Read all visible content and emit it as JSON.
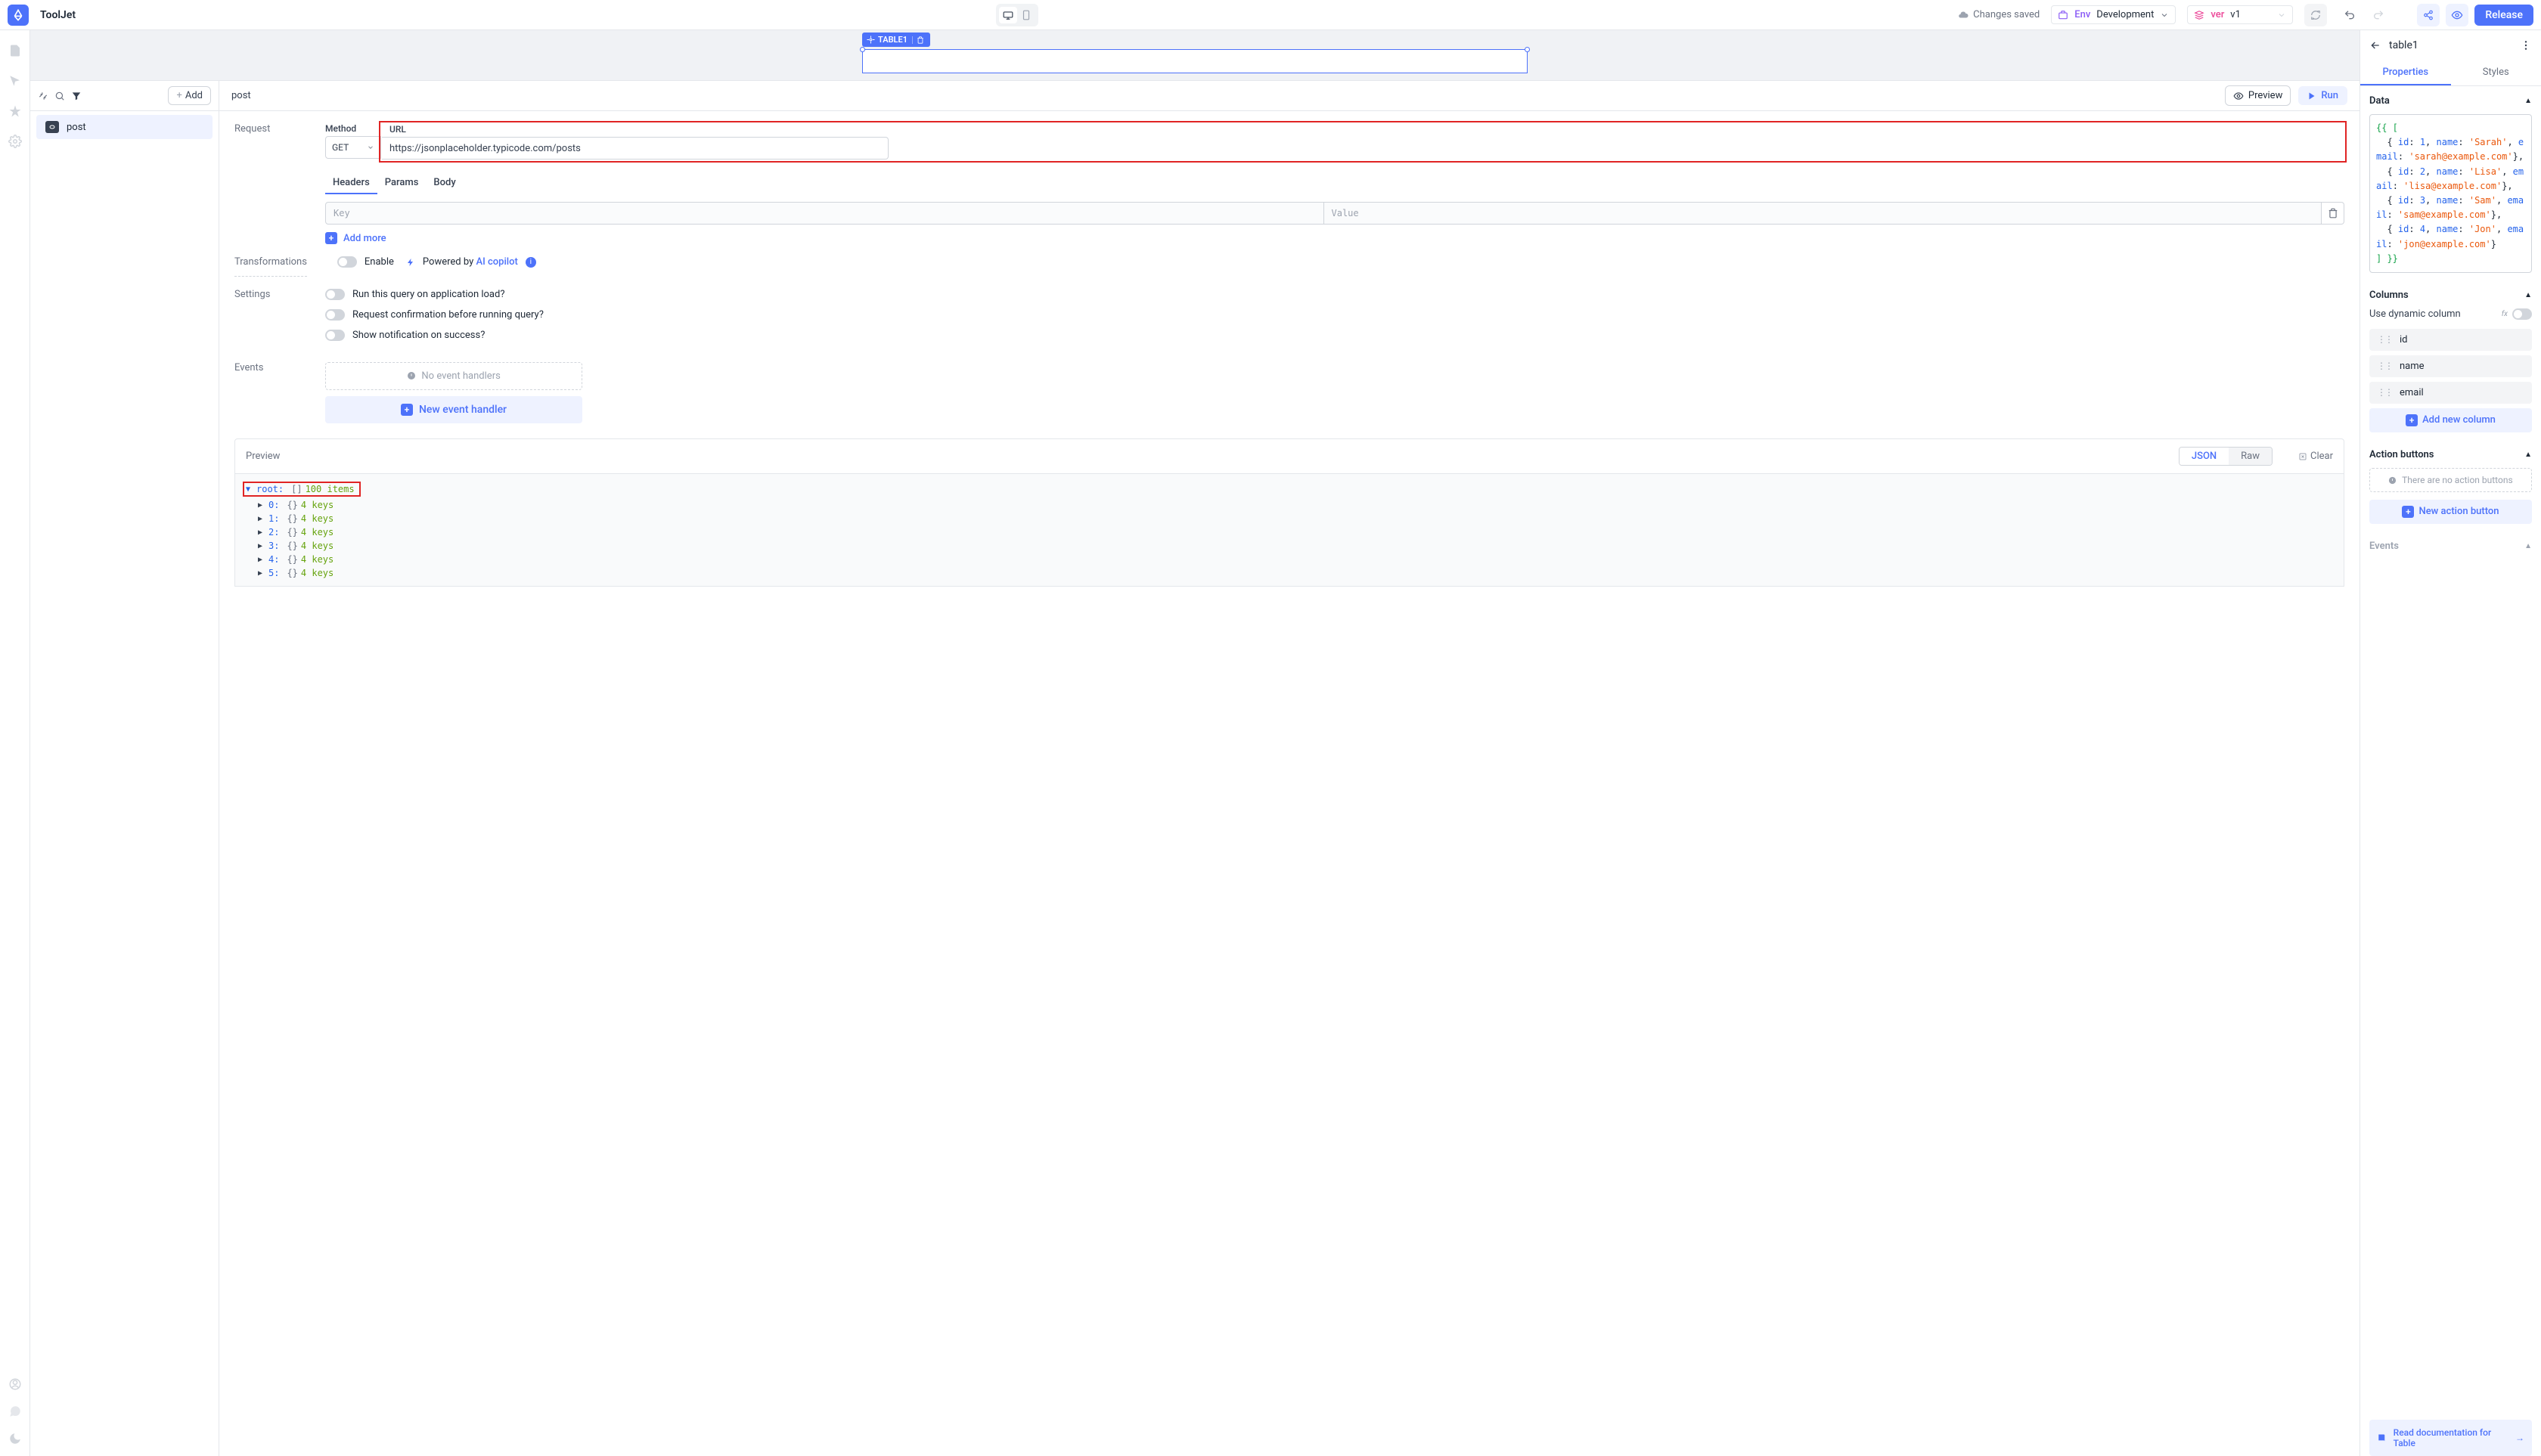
{
  "brand": "ToolJet",
  "topbar": {
    "saved": "Changes saved",
    "env_label": "Env",
    "env_value": "Development",
    "ver_label": "ver",
    "ver_value": "v1",
    "release": "Release"
  },
  "canvas": {
    "table_chip": "TABLE1"
  },
  "queries": {
    "add_btn": "Add",
    "items": [
      {
        "name": "post",
        "icon": "rest"
      }
    ],
    "current": "post",
    "preview_btn": "Preview",
    "run_btn": "Run",
    "request_label": "Request",
    "method_label": "Method",
    "method": "GET",
    "url_label": "URL",
    "url": "https://jsonplaceholder.typicode.com/posts",
    "subtabs": [
      "Headers",
      "Params",
      "Body"
    ],
    "kv_key_ph": "Key",
    "kv_val_ph": "Value",
    "add_more": "Add more",
    "transformations_label": "Transformations",
    "enable": "Enable",
    "powered_by": "Powered by ",
    "ai_copilot": "AI copilot",
    "settings_label": "Settings",
    "settings": [
      "Run this query on application load?",
      "Request confirmation before running query?",
      "Show notification on success?"
    ],
    "events_label": "Events",
    "no_events": "No event handlers",
    "new_event": "New event handler"
  },
  "results": {
    "preview_label": "Preview",
    "json_tab": "JSON",
    "raw_tab": "Raw",
    "clear": "Clear",
    "root_key": "root:",
    "root_meta": "100 items",
    "items": [
      {
        "k": "0:",
        "meta": "4 keys"
      },
      {
        "k": "1:",
        "meta": "4 keys"
      },
      {
        "k": "2:",
        "meta": "4 keys"
      },
      {
        "k": "3:",
        "meta": "4 keys"
      },
      {
        "k": "4:",
        "meta": "4 keys"
      },
      {
        "k": "5:",
        "meta": "4 keys"
      }
    ]
  },
  "inspector": {
    "title": "table1",
    "tabs": {
      "properties": "Properties",
      "styles": "Styles"
    },
    "data_section": "Data",
    "data_code": {
      "open": "{{ [",
      "rows": [
        {
          "id": 1,
          "name": "Sarah",
          "email": "sarah@example.com"
        },
        {
          "id": 2,
          "name": "Lisa",
          "email": "lisa@example.com"
        },
        {
          "id": 3,
          "name": "Sam",
          "email": "sam@example.com"
        },
        {
          "id": 4,
          "name": "Jon",
          "email": "jon@example.com"
        }
      ],
      "close": "] }}"
    },
    "columns_section": "Columns",
    "dynamic_col": "Use dynamic column",
    "columns": [
      "id",
      "name",
      "email"
    ],
    "add_column": "Add new column",
    "action_section": "Action buttons",
    "no_action": "There are no action buttons",
    "new_action": "New action button",
    "events_section": "Events",
    "doc_link": "Read documentation for Table"
  }
}
